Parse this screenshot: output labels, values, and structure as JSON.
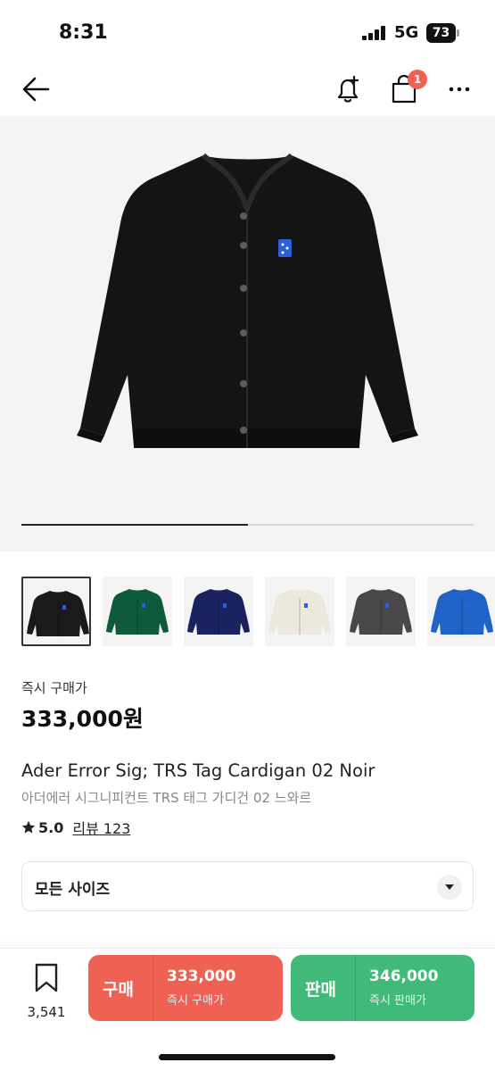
{
  "status_bar": {
    "time": "8:31",
    "network": "5G",
    "battery": "73"
  },
  "nav": {
    "back_icon": "arrow-left-icon",
    "bell_icon": "bell-plus-icon",
    "bag_icon": "shopping-bag-icon",
    "bag_badge": "1",
    "more_icon": "more-horizontal-icon",
    "badge_color": "#ef6253"
  },
  "gallery": {
    "image_index_progress": 0.5,
    "thumbnails": [
      {
        "color": "#1a1a1a",
        "selected": true
      },
      {
        "color": "#0f5a3a",
        "selected": false
      },
      {
        "color": "#1a2360",
        "selected": false
      },
      {
        "color": "#ece8dc",
        "selected": false
      },
      {
        "color": "#48484a",
        "selected": false
      },
      {
        "color": "#1f63c7",
        "selected": false
      }
    ]
  },
  "product": {
    "price_label": "즉시 구매가",
    "price": "333,000원",
    "name": "Ader Error Sig; TRS Tag Cardigan 02 Noir",
    "subname": "아더에러 시그니피컨트 TRS 태그 가디건 02 느와르",
    "rating": "5.0",
    "review": "리뷰 123"
  },
  "size_select": {
    "label": "모든 사이즈"
  },
  "bottom_bar": {
    "wish_count": "3,541",
    "buy": {
      "title": "구매",
      "price": "333,000",
      "sub": "즉시 구매가",
      "color": "#ef6253"
    },
    "sell": {
      "title": "판매",
      "price": "346,000",
      "sub": "즉시 판매가",
      "color": "#41b979"
    }
  }
}
